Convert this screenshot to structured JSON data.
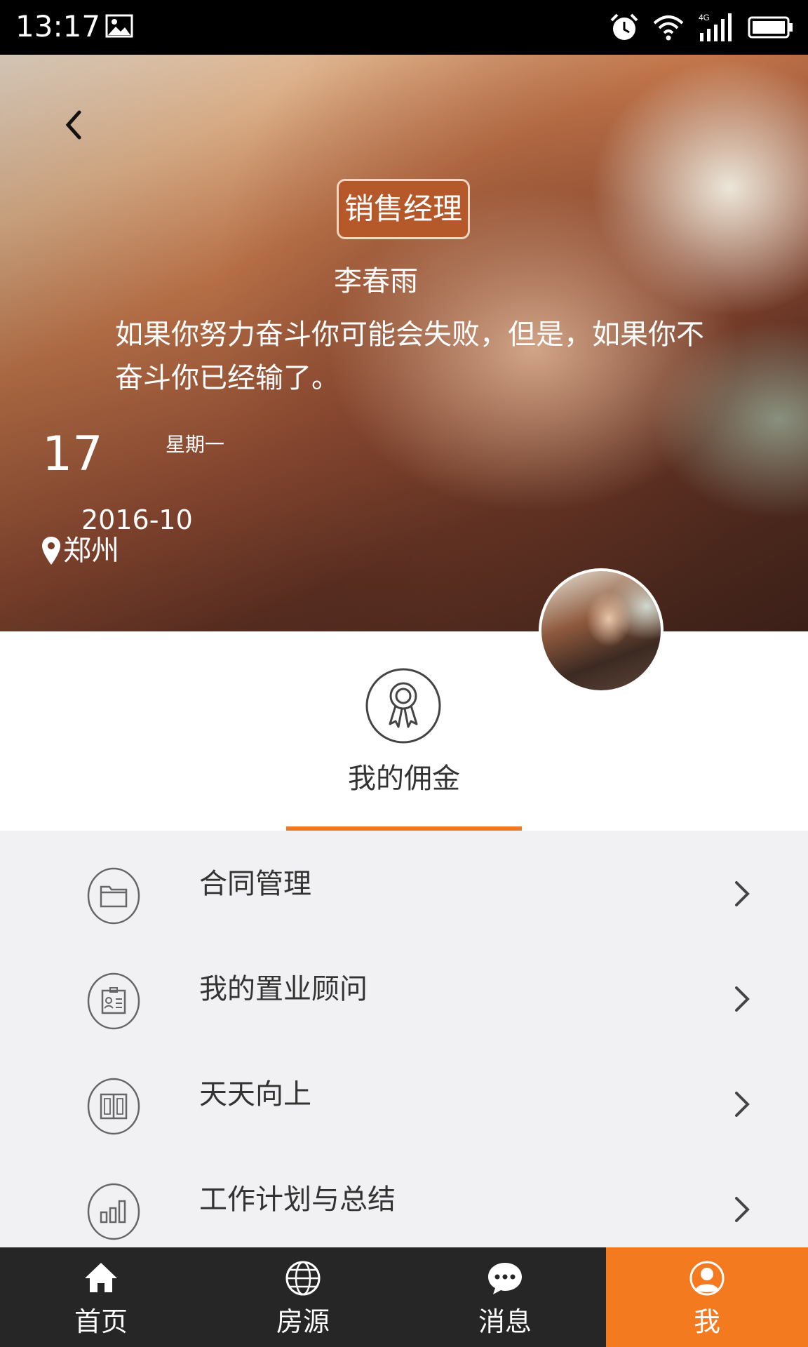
{
  "status_bar": {
    "time": "13:17",
    "icons": [
      "image-icon",
      "alarm-icon",
      "wifi-icon",
      "signal-4g-icon",
      "battery-icon"
    ],
    "network_label": "4G"
  },
  "profile": {
    "role_badge": "销售经理",
    "name": "李春雨",
    "motto": "如果你努力奋斗你可能会失败，但是，如果你不奋斗你已经输了。",
    "day": "17",
    "weekday": "星期一",
    "year_month": "2016-10",
    "location": "郑州"
  },
  "commission": {
    "label": "我的佣金",
    "icon": "medal-icon"
  },
  "menu": {
    "items": [
      {
        "label": "合同管理",
        "icon": "folder-icon"
      },
      {
        "label": "我的置业顾问",
        "icon": "id-card-icon"
      },
      {
        "label": "天天向上",
        "icon": "book-icon"
      },
      {
        "label": "工作计划与总结",
        "icon": "bar-chart-icon"
      }
    ]
  },
  "bottom_nav": {
    "items": [
      {
        "label": "首页",
        "icon": "home-icon"
      },
      {
        "label": "房源",
        "icon": "globe-icon"
      },
      {
        "label": "消息",
        "icon": "chat-icon"
      },
      {
        "label": "我",
        "icon": "user-icon",
        "active": true
      }
    ]
  },
  "colors": {
    "accent": "#f47a20",
    "badge": "#b5592a",
    "nav_background": "#262626",
    "menu_background": "#f1f1f3"
  }
}
